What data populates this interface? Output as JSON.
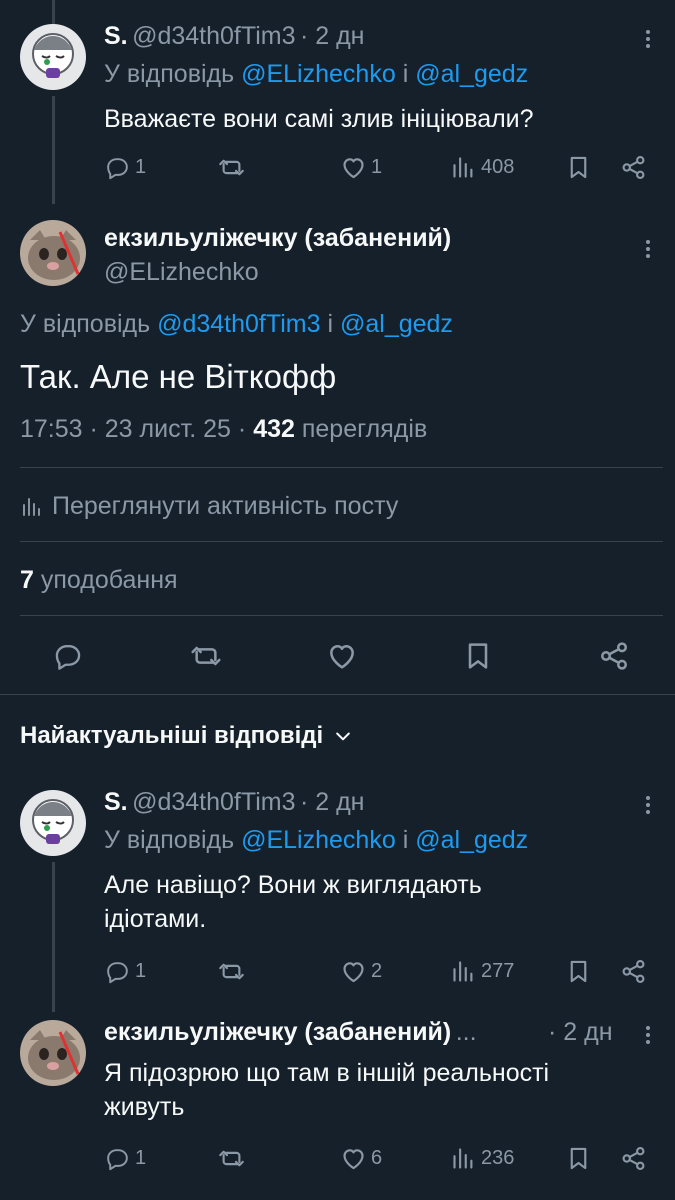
{
  "reply1": {
    "display_name": "S.",
    "handle": "@d34th0fTim3",
    "time": "· 2 дн",
    "reply_prefix": "У відповідь",
    "reply_to_1": "@ELizhechko",
    "reply_and": "і",
    "reply_to_2": "@al_gedz",
    "text": "Вважаєте вони самі злив ініціювали?",
    "replies": "1",
    "retweets": "",
    "likes": "1",
    "views": "408"
  },
  "main": {
    "display_name": "екзильуліжечку (забанений)",
    "handle": "@ELizhechko",
    "reply_prefix": "У відповідь",
    "reply_to_1": "@d34th0fTim3",
    "reply_and": "і",
    "reply_to_2": "@al_gedz",
    "text": "Так. Але не Віткофф",
    "time": "17:53 · 23 лист. 25 ·",
    "views_count": "432",
    "views_label": "переглядів",
    "activity_label": "Переглянути активність посту",
    "likes_count": "7",
    "likes_label": "уподобання"
  },
  "replies_header": {
    "label": "Найактуальніші відповіді"
  },
  "reply2": {
    "display_name": "S.",
    "handle": "@d34th0fTim3",
    "time": "· 2 дн",
    "reply_prefix": "У відповідь",
    "reply_to_1": "@ELizhechko",
    "reply_and": "і",
    "reply_to_2": "@al_gedz",
    "text_line1": "Але навіщо? Вони ж виглядають",
    "text_line2": "ідіотами.",
    "replies": "1",
    "likes": "2",
    "views": "277"
  },
  "reply3": {
    "display_name": "екзильуліжечку (забанений)",
    "ellipsis": "...",
    "time": "· 2 дн",
    "text_line1": "Я підозрюю що там в іншій реальності",
    "text_line2": "живуть",
    "replies": "1",
    "likes": "6",
    "views": "236"
  },
  "colors": {
    "background": "#15202b",
    "text": "#f7f9f9",
    "muted": "#8b98a5",
    "link": "#1d9bf0",
    "divider": "#38444d"
  }
}
